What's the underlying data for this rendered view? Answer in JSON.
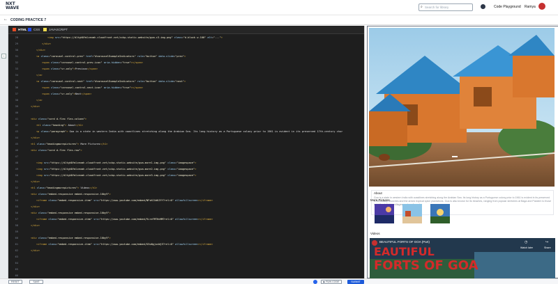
{
  "header": {
    "logo_top": "NXT",
    "logo_bottom": "WAVE",
    "search_placeholder": "Search for library",
    "code_playground": "Code Playground",
    "username": "Ramya"
  },
  "breadcrumb": {
    "back_icon": "arrow-left-icon",
    "title": "CODING PRACTICE 7"
  },
  "editor": {
    "tabs": [
      {
        "label": "HTML",
        "active": true
      },
      {
        "label": "CSS",
        "active": false
      },
      {
        "label": "JAVASCRIPT",
        "active": false
      }
    ],
    "lines": [
      {
        "n": "28",
        "indent": 4,
        "html": "<span class='tag'>&lt;img</span> <span class='attr'>src</span>=<span class='str'>\"https://d1tgh8fmlzexmh.cloudfront.net/ccbp-static-website/goa-c3-img.png\"</span> <span class='attr'>class</span>=<span class='str'>\"d-block w-100\"</span> <span class='attr'>alt</span>=<span class='str'>\"...\"</span><span class='tag'>&gt;</span>"
      },
      {
        "n": "29",
        "indent": 3,
        "html": "<span class='tag'>&lt;/div&gt;</span>"
      },
      {
        "n": "30",
        "indent": 2,
        "html": "<span class='tag'>&lt;/div&gt;</span>"
      },
      {
        "n": "31",
        "indent": 2,
        "html": "<span class='tag'>&lt;a</span> <span class='attr'>class</span>=<span class='str'>\"carousel-control-prev\"</span> <span class='attr'>href</span>=<span class='str'>\"#carouselExampleIndicators\"</span> <span class='attr'>role</span>=<span class='str'>\"button\"</span> <span class='attr'>data-slide</span>=<span class='str'>\"prev\"</span><span class='tag'>&gt;</span>"
      },
      {
        "n": "32",
        "indent": 3,
        "html": "<span class='tag'>&lt;span</span> <span class='attr'>class</span>=<span class='str'>\"carousel-control-prev-icon\"</span> <span class='attr'>aria-hidden</span>=<span class='str'>\"true\"</span><span class='tag'>&gt;&lt;/span&gt;</span>"
      },
      {
        "n": "33",
        "indent": 3,
        "html": "<span class='tag'>&lt;span</span> <span class='attr'>class</span>=<span class='str'>\"sr-only\"</span><span class='tag'>&gt;</span>Previous<span class='tag'>&lt;/span&gt;</span>"
      },
      {
        "n": "34",
        "indent": 2,
        "html": "<span class='tag'>&lt;/a&gt;</span>"
      },
      {
        "n": "35",
        "indent": 2,
        "html": "<span class='tag'>&lt;a</span> <span class='attr'>class</span>=<span class='str'>\"carousel-control-next\"</span> <span class='attr'>href</span>=<span class='str'>\"#carouselExampleIndicators\"</span> <span class='attr'>role</span>=<span class='str'>\"button\"</span> <span class='attr'>data-slide</span>=<span class='str'>\"next\"</span><span class='tag'>&gt;</span>"
      },
      {
        "n": "36",
        "indent": 3,
        "html": "<span class='tag'>&lt;span</span> <span class='attr'>class</span>=<span class='str'>\"carousel-control-next-icon\"</span> <span class='attr'>aria-hidden</span>=<span class='str'>\"true\"</span><span class='tag'>&gt;&lt;/span&gt;</span>"
      },
      {
        "n": "37",
        "indent": 3,
        "html": "<span class='tag'>&lt;span</span> <span class='attr'>class</span>=<span class='str'>\"sr-only\"</span><span class='tag'>&gt;</span>Next<span class='tag'>&lt;/span&gt;</span>"
      },
      {
        "n": "38",
        "indent": 2,
        "html": "<span class='tag'>&lt;/a&gt;</span>"
      },
      {
        "n": "39",
        "indent": 1,
        "html": "<span class='tag'>&lt;/div&gt;</span>"
      },
      {
        "n": "40",
        "indent": 0,
        "html": ""
      },
      {
        "n": "41",
        "indent": 1,
        "html": "<span class='tag'>&lt;div</span> <span class='attr'>class</span>=<span class='str'>\"card d-flex flex-column\"</span><span class='tag'>&gt;</span>"
      },
      {
        "n": "42",
        "indent": 2,
        "html": "<span class='tag'>&lt;h1</span> <span class='attr'>class</span>=<span class='str'>\"heading\"</span><span class='tag'>&gt;</span> About<span class='tag'>&lt;/h1&gt;</span>"
      },
      {
        "n": "43",
        "indent": 2,
        "html": "<span class='tag'>&lt;p</span> <span class='attr'>class</span>=<span class='str'>\"paragraph\"</span><span class='tag'>&gt;</span> Goa is a state in western India with coastlines stretching along the Arabian Sea. Its long history as a Portuguese colony prior to 1961 is evident in its preserved 17th-century chur"
      },
      {
        "n": "44",
        "indent": 1,
        "html": "<span class='tag'>&lt;/div&gt;</span>"
      },
      {
        "n": "45",
        "indent": 1,
        "html": "<span class='tag'>&lt;h1</span> <span class='attr'>class</span>=<span class='str'>\"headingmorepictures\"</span><span class='tag'>&gt;</span> More Pictures<span class='tag'>&lt;/h1&gt;</span>"
      },
      {
        "n": "46",
        "indent": 1,
        "html": "<span class='tag'>&lt;div</span> <span class='attr'>class</span>=<span class='str'>\"card d-flex flex-row\"</span><span class='tag'>&gt;</span>"
      },
      {
        "n": "47",
        "indent": 0,
        "html": ""
      },
      {
        "n": "48",
        "indent": 2,
        "html": "<span class='tag'>&lt;img</span> <span class='attr'>src</span>=<span class='str'>\"https://d1tgh8fmlzexmh.cloudfront.net/ccbp-static-website/goa-more1-img.png\"</span> <span class='attr'>class</span>=<span class='str'>\"imagespace\"</span><span class='tag'>&gt;</span>"
      },
      {
        "n": "49",
        "indent": 2,
        "html": "<span class='tag'>&lt;img</span> <span class='attr'>src</span>=<span class='str'>\"https://d1tgh8fmlzexmh.cloudfront.net/ccbp-static-website/goa-more2-img.png\"</span> <span class='attr'>class</span>=<span class='str'>\"imagespace\"</span><span class='tag'>&gt;</span>"
      },
      {
        "n": "50",
        "indent": 2,
        "html": "<span class='tag'>&lt;img</span> <span class='attr'>src</span>=<span class='str'>\"https://d1tgh8fmlzexmh.cloudfront.net/ccbp-static-website/goa-more3-img.png\"</span> <span class='attr'>class</span>=<span class='str'>\"imagespace\"</span><span class='tag'>&gt;</span>"
      },
      {
        "n": "51",
        "indent": 1,
        "html": "<span class='tag'>&lt;/div&gt;</span>"
      },
      {
        "n": "52",
        "indent": 1,
        "html": "<span class='tag'>&lt;h1</span> <span class='attr'>class</span>=<span class='str'>\"headingmorepictures\"</span><span class='tag'>&gt;</span> Videos<span class='tag'>&lt;/h1&gt;</span>"
      },
      {
        "n": "53",
        "indent": 1,
        "html": "<span class='tag'>&lt;div</span> <span class='attr'>class</span>=<span class='str'>\"embed-responsive embed-responsive-16by9\"</span><span class='tag'>&gt;</span>"
      },
      {
        "n": "54",
        "indent": 2,
        "html": "<span class='tag'>&lt;iframe</span> <span class='attr'>class</span>=<span class='str'>\"embed-responsive-item\"</span> <span class='attr'>src</span>=<span class='str'>\"https://www.youtube.com/embed/NFsKCXdKZfY?rel=0\"</span> <span class='attr'>allowfullscreen</span><span class='tag'>&gt;&lt;/iframe&gt;</span>"
      },
      {
        "n": "55",
        "indent": 1,
        "html": "<span class='tag'>&lt;/div&gt;</span>"
      },
      {
        "n": "56",
        "indent": 1,
        "html": "<span class='tag'>&lt;div</span> <span class='attr'>class</span>=<span class='str'>\"embed-responsive embed-responsive-16by9\"</span><span class='tag'>&gt;</span>"
      },
      {
        "n": "57",
        "indent": 2,
        "html": "<span class='tag'>&lt;iframe</span> <span class='attr'>class</span>=<span class='str'>\"embed-responsive-item\"</span> <span class='attr'>src</span>=<span class='str'>\"https://www.youtube.com/embed/9ireFMTHnMM?rel=0\"</span> <span class='attr'>allowfullscreen</span><span class='tag'>&gt;&lt;/iframe&gt;</span>"
      },
      {
        "n": "58",
        "indent": 1,
        "html": "<span class='tag'>&lt;/div&gt;</span>"
      },
      {
        "n": "59",
        "indent": 0,
        "html": ""
      },
      {
        "n": "60",
        "indent": 1,
        "html": "<span class='tag'>&lt;div</span> <span class='attr'>class</span>=<span class='str'>\"embed-responsive embed-responsive-16by9\"</span><span class='tag'>&gt;</span>"
      },
      {
        "n": "61",
        "indent": 2,
        "html": "<span class='tag'>&lt;iframe</span> <span class='attr'>class</span>=<span class='str'>\"embed-responsive-item\"</span> <span class='attr'>src</span>=<span class='str'>\"https://www.youtube.com/embed/U3uNgjuvWjE?rel=0\"</span> <span class='attr'>allowfullscreen</span><span class='tag'>&gt;&lt;/iframe&gt;</span>"
      },
      {
        "n": "62",
        "indent": 1,
        "html": "<span class='tag'>&lt;/div&gt;</span>"
      },
      {
        "n": "63",
        "indent": 0,
        "html": ""
      },
      {
        "n": "64",
        "indent": 0,
        "html": ""
      },
      {
        "n": "65",
        "indent": 0,
        "html": ""
      },
      {
        "n": "66",
        "indent": 0,
        "html": ""
      },
      {
        "n": "67",
        "indent": 0,
        "html": ""
      }
    ]
  },
  "bottom": {
    "reset": "RESET",
    "save": "SAVE",
    "run_code": "▶ RUN CODE",
    "submit": "SUBMIT"
  },
  "preview": {
    "about_title": "About",
    "about_text": "Goa is a state in western India with coastlines stretching along the Arabian Sea. Its long history as a Portuguese colony prior to 1961 is evident in its preserved 17th-century churches and the area's tropical spice plantations. Goa is also known for its beaches, ranging from popular stretches at Baga and Palolem to those in laidback fishing villages such as Agonda.",
    "more_pictures": "More Pictures",
    "videos": "Videos",
    "video_title": "BEAUTIFUL FORTS OF GOA (Part)",
    "video_overlay_1": "EAUTIFUL",
    "video_overlay_2": "FORTS OF GOA",
    "watch_later": "Watch later",
    "share": "Share"
  }
}
